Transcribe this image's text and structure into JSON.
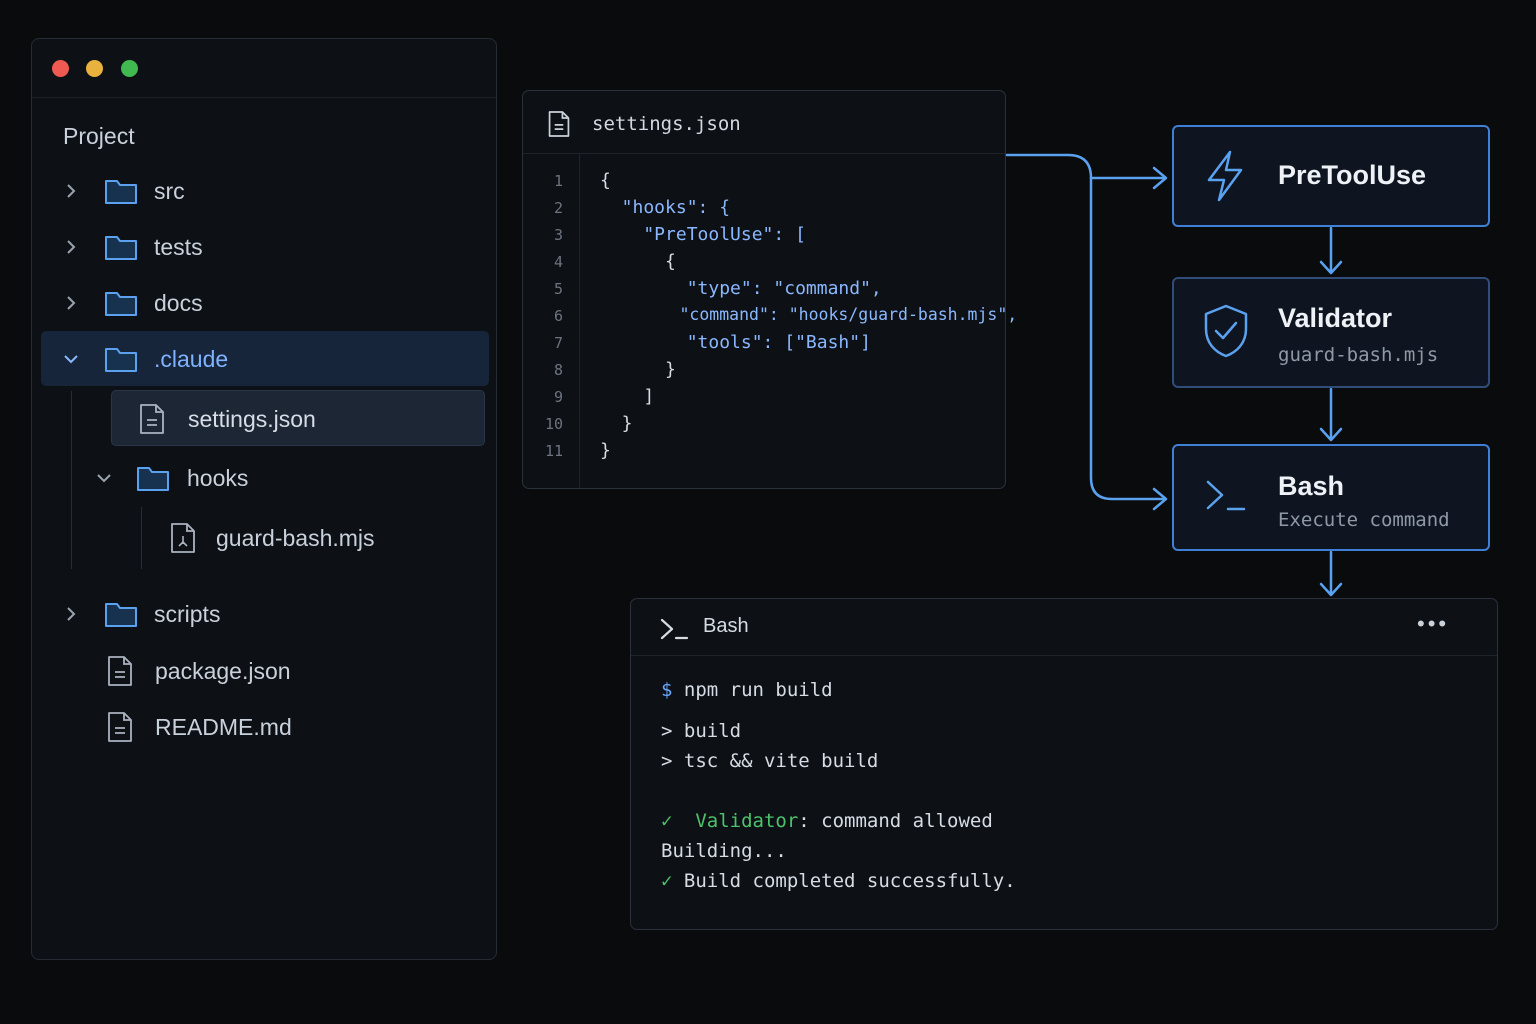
{
  "explorer": {
    "title": "Project",
    "items": [
      {
        "label": "src"
      },
      {
        "label": "tests"
      },
      {
        "label": "docs"
      },
      {
        "label": ".claude"
      },
      {
        "label": "settings.json"
      },
      {
        "label": "hooks"
      },
      {
        "label": "guard-bash.mjs"
      },
      {
        "label": "scripts"
      },
      {
        "label": "package.json"
      },
      {
        "label": "README.md"
      }
    ]
  },
  "editor": {
    "filename": "settings.json",
    "line_numbers": [
      "1",
      "2",
      "3",
      "4",
      "5",
      "6",
      "7",
      "8",
      "9",
      "10",
      "11"
    ],
    "lines": [
      "{",
      "  \"hooks\": {",
      "    \"PreToolUse\": [",
      "      {",
      "        \"type\": \"command\",",
      "        \"command\": \"hooks/guard-bash.mjs\",",
      "        \"tools\": [\"Bash\"]",
      "      }",
      "    ]",
      "  }",
      "}"
    ]
  },
  "flow": {
    "pretooluse": {
      "title": "PreToolUse"
    },
    "validator": {
      "title": "Validator",
      "subtitle": "guard-bash.mjs"
    },
    "bash": {
      "title": "Bash",
      "subtitle": "Execute command"
    }
  },
  "terminal": {
    "title": "Bash",
    "menu": "•••",
    "prompt": "$",
    "command": "npm run build",
    "output1": "> build",
    "output2": "> tsc && vite build",
    "check_mark": "✓",
    "validator_label": "Validator",
    "validator_msg": ": command allowed",
    "building": "Building...",
    "done": "Build completed successfully."
  },
  "colors": {
    "accent": "#3f7fd6",
    "folder": "#5aa2f0",
    "success": "#4cc36a",
    "selection": "#17253a"
  }
}
